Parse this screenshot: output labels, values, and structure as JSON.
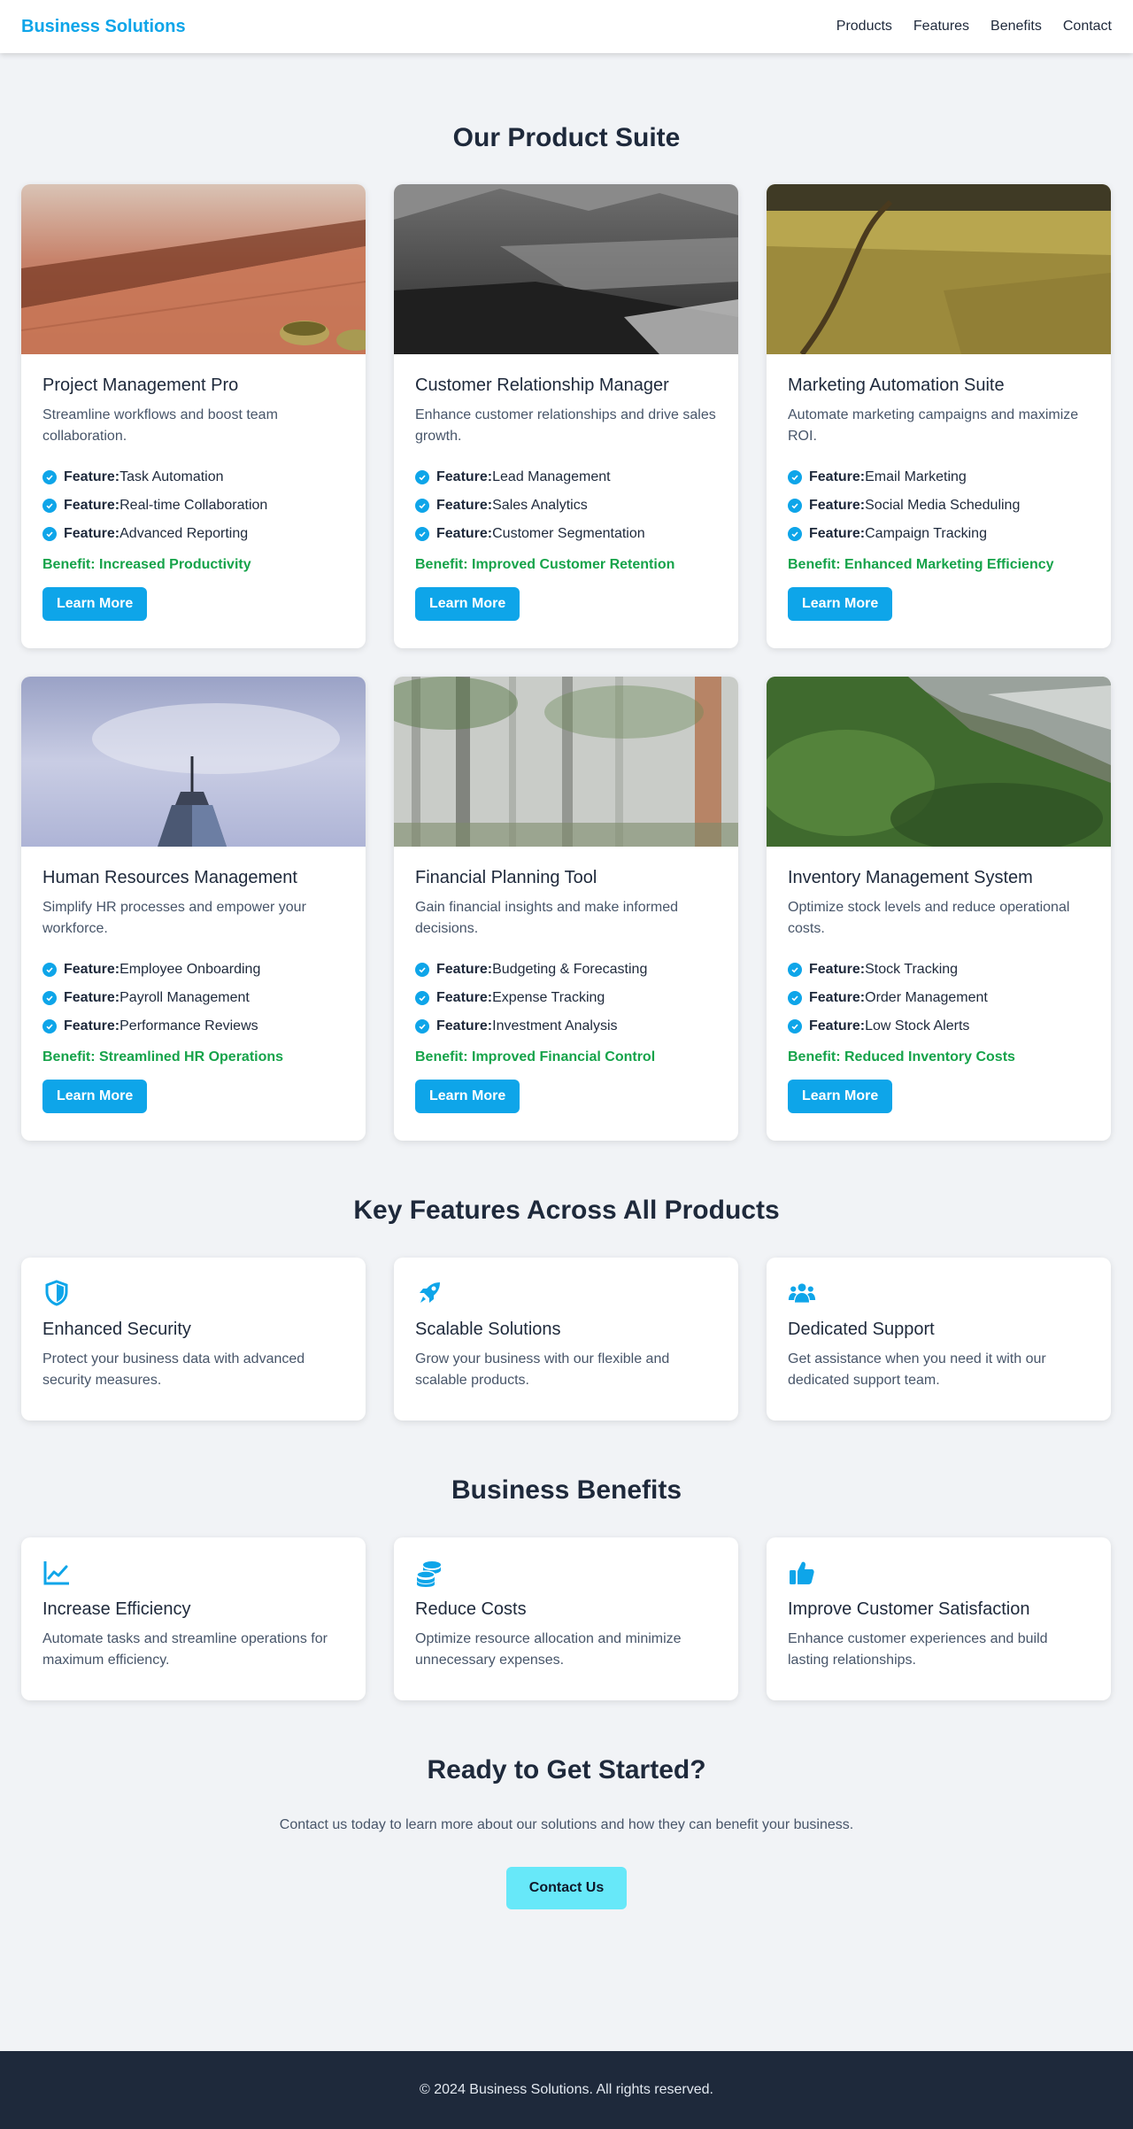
{
  "colors": {
    "accent": "#0ea5e9",
    "benefit_green": "#16a34a",
    "cta_button": "#67e8f9",
    "footer_bg": "#1e293b",
    "page_bg": "#f1f3f6"
  },
  "nav": {
    "brand": "Business Solutions",
    "links": [
      "Products",
      "Features",
      "Benefits",
      "Contact"
    ]
  },
  "products": {
    "title": "Our Product Suite",
    "feature_prefix": "Feature:",
    "button_label": "Learn More",
    "items": [
      {
        "image": "wooden-table-photo",
        "title": "Project Management Pro",
        "description": "Streamline workflows and boost team collaboration.",
        "features": [
          "Task Automation",
          "Real-time Collaboration",
          "Advanced Reporting"
        ],
        "benefit": "Benefit: Increased Productivity"
      },
      {
        "image": "mountain-slope-photo",
        "title": "Customer Relationship Manager",
        "description": "Enhance customer relationships and drive sales growth.",
        "features": [
          "Lead Management",
          "Sales Analytics",
          "Customer Segmentation"
        ],
        "benefit": "Benefit: Improved Customer Retention"
      },
      {
        "image": "grass-field-photo",
        "title": "Marketing Automation Suite",
        "description": "Automate marketing campaigns and maximize ROI.",
        "features": [
          "Email Marketing",
          "Social Media Scheduling",
          "Campaign Tracking"
        ],
        "benefit": "Benefit: Enhanced Marketing Efficiency"
      },
      {
        "image": "skyscraper-sky-photo",
        "title": "Human Resources Management",
        "description": "Simplify HR processes and empower your workforce.",
        "features": [
          "Employee Onboarding",
          "Payroll Management",
          "Performance Reviews"
        ],
        "benefit": "Benefit: Streamlined HR Operations"
      },
      {
        "image": "misty-forest-photo",
        "title": "Financial Planning Tool",
        "description": "Gain financial insights and make informed decisions.",
        "features": [
          "Budgeting & Forecasting",
          "Expense Tracking",
          "Investment Analysis"
        ],
        "benefit": "Benefit: Improved Financial Control"
      },
      {
        "image": "green-mountain-photo",
        "title": "Inventory Management System",
        "description": "Optimize stock levels and reduce operational costs.",
        "features": [
          "Stock Tracking",
          "Order Management",
          "Low Stock Alerts"
        ],
        "benefit": "Benefit: Reduced Inventory Costs"
      }
    ]
  },
  "key_features": {
    "title": "Key Features Across All Products",
    "items": [
      {
        "icon": "shield-icon",
        "title": "Enhanced Security",
        "description": "Protect your business data with advanced security measures."
      },
      {
        "icon": "rocket-icon",
        "title": "Scalable Solutions",
        "description": "Grow your business with our flexible and scalable products."
      },
      {
        "icon": "users-icon",
        "title": "Dedicated Support",
        "description": "Get assistance when you need it with our dedicated support team."
      }
    ]
  },
  "benefits": {
    "title": "Business Benefits",
    "items": [
      {
        "icon": "chart-line-icon",
        "title": "Increase Efficiency",
        "description": "Automate tasks and streamline operations for maximum efficiency."
      },
      {
        "icon": "coins-icon",
        "title": "Reduce Costs",
        "description": "Optimize resource allocation and minimize unnecessary expenses."
      },
      {
        "icon": "thumbs-up-icon",
        "title": "Improve Customer Satisfaction",
        "description": "Enhance customer experiences and build lasting relationships."
      }
    ]
  },
  "cta": {
    "title": "Ready to Get Started?",
    "text": "Contact us today to learn more about our solutions and how they can benefit your business.",
    "button": "Contact Us"
  },
  "footer": {
    "text": "© 2024 Business Solutions. All rights reserved."
  }
}
